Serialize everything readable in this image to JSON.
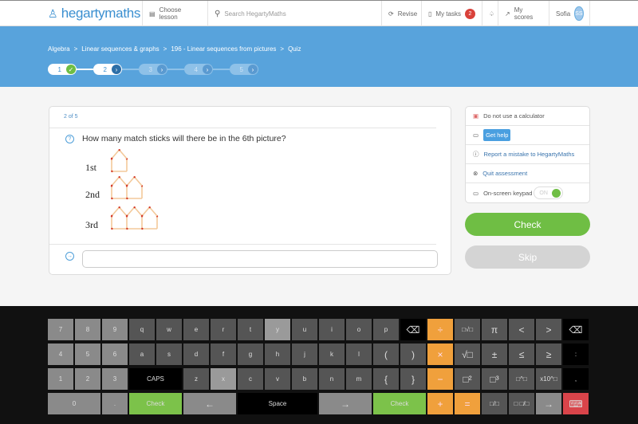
{
  "header": {
    "logo": "hegartymaths",
    "choose_lesson": "Choose lesson",
    "search_placeholder": "Search HegartyMaths",
    "revise": "Revise",
    "my_tasks": "My tasks",
    "tasks_count": "2",
    "my_scores": "My scores",
    "user": "Sofia",
    "initials": "SS"
  },
  "breadcrumb": [
    "Algebra",
    ">",
    "Linear sequences & graphs",
    ">",
    "196 - Linear sequences from pictures",
    ">",
    "Quiz"
  ],
  "steps": [
    {
      "n": "1",
      "state": "done"
    },
    {
      "n": "2",
      "state": "current"
    },
    {
      "n": "3",
      "state": "todo"
    },
    {
      "n": "4",
      "state": "todo"
    },
    {
      "n": "5",
      "state": "todo"
    }
  ],
  "question": {
    "counter": "2 of 5",
    "text": "How many match sticks will there be in the 6th picture?",
    "pictures": [
      {
        "label": "1st",
        "houses": 1
      },
      {
        "label": "2nd",
        "houses": 2
      },
      {
        "label": "3rd",
        "houses": 3
      }
    ],
    "answer": ""
  },
  "side": {
    "calculator": "Do not use a calculator",
    "get_help": "Get help",
    "report": "Report a mistake to HegartyMaths",
    "quit": "Quit assessment",
    "keypad": "On-screen keypad",
    "keypad_state": "ON"
  },
  "actions": {
    "check": "Check",
    "skip": "Skip"
  },
  "colors": {
    "brand_blue": "#58a3dc",
    "green": "#6fbe44",
    "orange": "#f0a03c"
  },
  "keyboard": {
    "rows": [
      [
        [
          "7",
          "light"
        ],
        [
          "8",
          "light"
        ],
        [
          "9",
          "light"
        ],
        [
          "q",
          "dark"
        ],
        [
          "w",
          "dark"
        ],
        [
          "e",
          "dark"
        ],
        [
          "r",
          "dark"
        ],
        [
          "t",
          "dark"
        ],
        [
          "y",
          "hi"
        ],
        [
          "u",
          "dark"
        ],
        [
          "i",
          "dark"
        ],
        [
          "o",
          "dark"
        ],
        [
          "p",
          "dark"
        ],
        [
          "⌫",
          "black"
        ],
        [
          "÷",
          "orange"
        ],
        [
          "□√□",
          "dark"
        ],
        [
          "π",
          "dark"
        ],
        [
          "<",
          "dark"
        ],
        [
          ">",
          "dark"
        ],
        [
          "⌫",
          "black"
        ]
      ],
      [
        [
          "4",
          "light"
        ],
        [
          "5",
          "light"
        ],
        [
          "6",
          "light"
        ],
        [
          "a",
          "dark"
        ],
        [
          "s",
          "dark"
        ],
        [
          "d",
          "dark"
        ],
        [
          "f",
          "dark"
        ],
        [
          "g",
          "dark"
        ],
        [
          "h",
          "dark"
        ],
        [
          "j",
          "dark"
        ],
        [
          "k",
          "dark"
        ],
        [
          "l",
          "dark"
        ],
        [
          "(",
          "dark"
        ],
        [
          ")",
          "dark"
        ],
        [
          "×",
          "orange"
        ],
        [
          "√□",
          "dark"
        ],
        [
          "±",
          "dark"
        ],
        [
          "≤",
          "dark"
        ],
        [
          "≥",
          "dark"
        ],
        [
          ":",
          "black"
        ]
      ],
      [
        [
          "1",
          "light"
        ],
        [
          "2",
          "light"
        ],
        [
          "3",
          "light"
        ],
        [
          "CAPS",
          "black",
          2
        ],
        [
          "z",
          "dark"
        ],
        [
          "x",
          "hi"
        ],
        [
          "c",
          "dark"
        ],
        [
          "v",
          "dark"
        ],
        [
          "b",
          "dark"
        ],
        [
          "n",
          "dark"
        ],
        [
          "m",
          "dark"
        ],
        [
          "{",
          "dark"
        ],
        [
          "}",
          "dark"
        ],
        [
          "−",
          "orange"
        ],
        [
          "□²",
          "dark"
        ],
        [
          "□³",
          "dark"
        ],
        [
          "□^□",
          "dark"
        ],
        [
          "x10^□",
          "dark"
        ],
        [
          ",",
          "black"
        ]
      ],
      [
        [
          "0",
          "light",
          2
        ],
        [
          ".",
          "light"
        ],
        [
          "Check",
          "green",
          2
        ],
        [
          "←",
          "light",
          2
        ],
        [
          "Space",
          "black",
          3
        ],
        [
          "→",
          "light",
          2
        ],
        [
          "Check",
          "green",
          2
        ],
        [
          "+",
          "orange"
        ],
        [
          "=",
          "orange"
        ],
        [
          "□/□",
          "dark"
        ],
        [
          "□ □/□",
          "dark"
        ],
        [
          "→",
          "light"
        ],
        [
          "⌨",
          "red"
        ]
      ]
    ]
  }
}
